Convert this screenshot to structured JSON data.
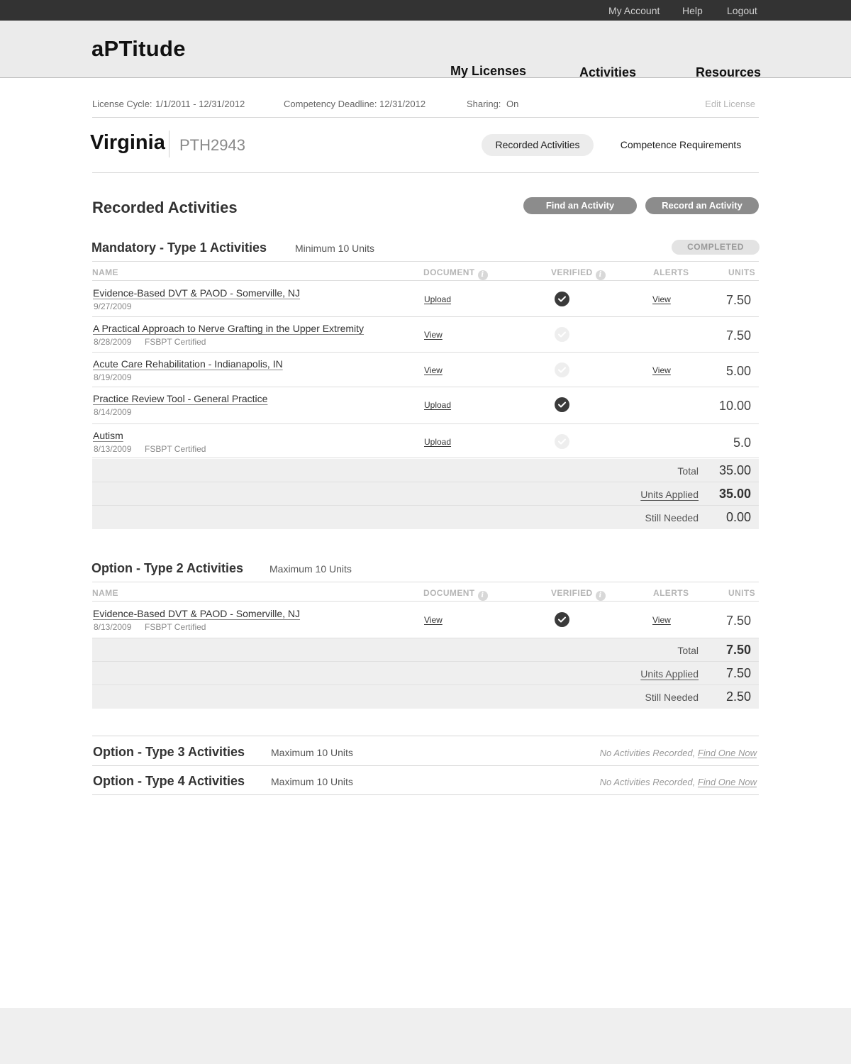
{
  "util_nav": {
    "my_account": "My Account",
    "help": "Help",
    "logout": "Logout"
  },
  "logo": "aPTitude",
  "main_nav": {
    "licenses": "My Licenses",
    "activities": "Activities",
    "resources": "Resources"
  },
  "license_info": {
    "cycle_label": "License Cycle:",
    "cycle_value": "1/1/2011 - 12/31/2012",
    "deadline_label": "Competency Deadline:",
    "deadline_value": "12/31/2012",
    "sharing_label": "Sharing:",
    "sharing_value": "On",
    "edit": "Edit License"
  },
  "license": {
    "state": "Virginia",
    "number": "PTH2943"
  },
  "tabs": {
    "recorded": "Recorded Activities",
    "requirements": "Competence Requirements"
  },
  "page_title": "Recorded Activities",
  "buttons": {
    "find": "Find an Activity",
    "record": "Record an Activity"
  },
  "columns": {
    "name": "NAME",
    "document": "DOCUMENT",
    "verified": "VERIFIED",
    "alerts": "ALERTS",
    "units": "UNITS"
  },
  "section1": {
    "title": "Mandatory - Type 1 Activities",
    "subtitle": "Minimum 10 Units",
    "status": "COMPLETED",
    "rows": [
      {
        "name": "Evidence-Based DVT & PAOD - Somerville, NJ",
        "date": "9/27/2009",
        "cert": "",
        "doc": "Upload",
        "verified": true,
        "alert": "View",
        "units": "7.50"
      },
      {
        "name": "A Practical Approach to Nerve Grafting in the Upper Extremity",
        "date": "8/28/2009",
        "cert": "FSBPT Certified",
        "doc": "View",
        "verified": false,
        "alert": "",
        "units": "7.50"
      },
      {
        "name": "Acute Care Rehabilitation - Indianapolis, IN",
        "date": "8/19/2009",
        "cert": "",
        "doc": "View",
        "verified": false,
        "alert": "View",
        "units": "5.00"
      },
      {
        "name": "Practice Review Tool - General Practice",
        "date": "8/14/2009",
        "cert": "",
        "doc": "Upload",
        "verified": true,
        "alert": "",
        "units": "10.00"
      },
      {
        "name": "Autism",
        "date": "8/13/2009",
        "cert": "FSBPT Certified",
        "doc": "Upload",
        "verified": false,
        "alert": "",
        "units": "5.0"
      }
    ],
    "totals": {
      "total_label": "Total",
      "total": "35.00",
      "applied_label": "Units Applied",
      "applied": "35.00",
      "needed_label": "Still Needed",
      "needed": "0.00"
    }
  },
  "section2": {
    "title": "Option - Type 2 Activities",
    "subtitle": "Maximum 10 Units",
    "rows": [
      {
        "name": "Evidence-Based DVT & PAOD - Somerville, NJ",
        "date": "8/13/2009",
        "cert": "FSBPT Certified",
        "doc": "View",
        "verified": true,
        "alert": "View",
        "units": "7.50"
      }
    ],
    "totals": {
      "total_label": "Total",
      "total": "7.50",
      "applied_label": "Units Applied",
      "applied": "7.50",
      "needed_label": "Still Needed",
      "needed": "2.50"
    }
  },
  "section3": {
    "title": "Option - Type 3 Activities",
    "subtitle": "Maximum 10 Units",
    "empty": "No Activities Recorded,",
    "link": "Find One Now"
  },
  "section4": {
    "title": "Option - Type 4 Activities",
    "subtitle": "Maximum 10 Units",
    "empty": "No Activities Recorded,",
    "link": "Find One Now"
  }
}
